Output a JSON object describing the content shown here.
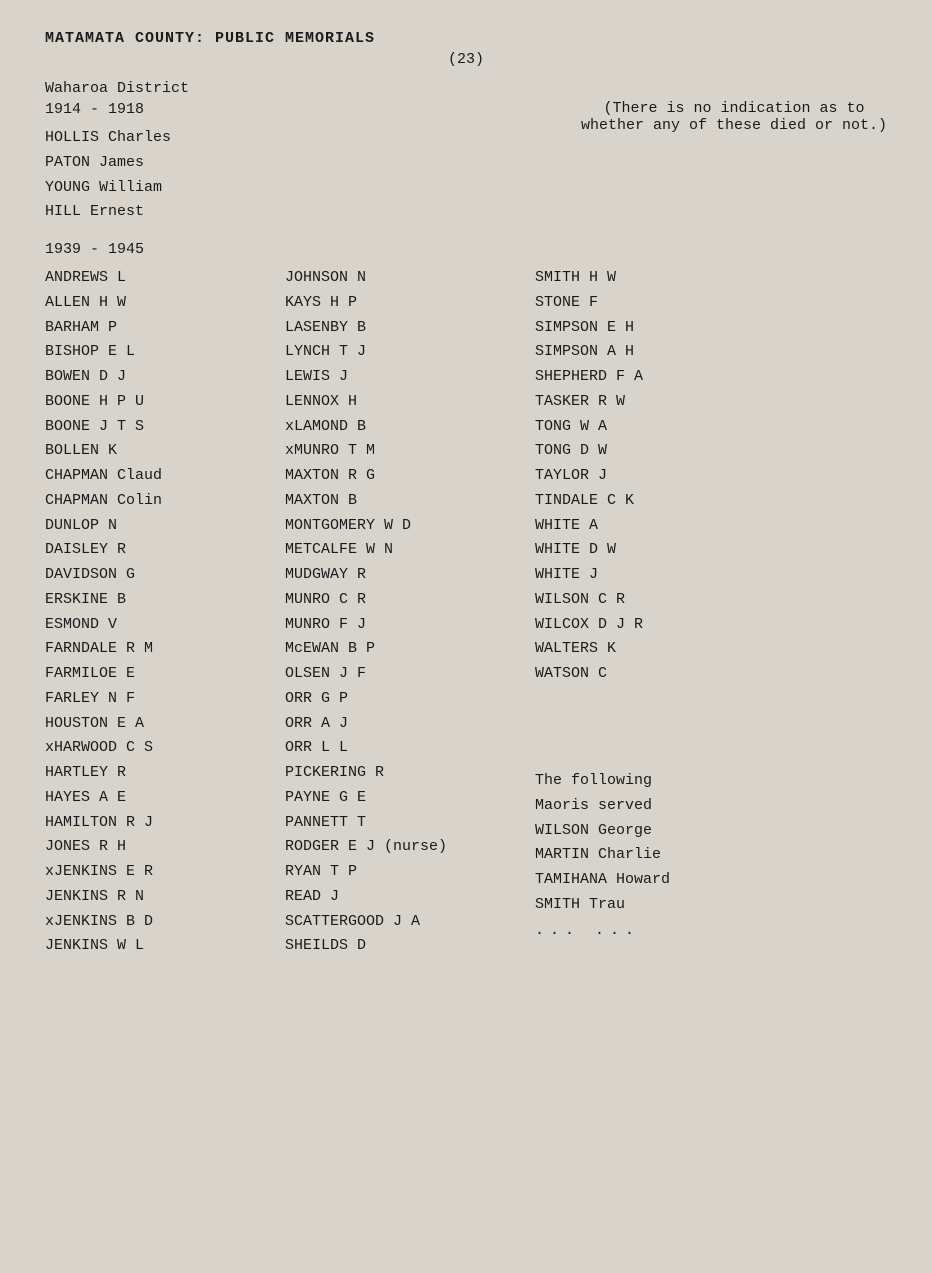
{
  "header": {
    "title": "MATAMATA COUNTY: PUBLIC MEMORIALS",
    "page_number": "(23)"
  },
  "district": {
    "name": "Waharoa District",
    "year_range_ww1": "1914 - 1918",
    "names_ww1": [
      "HOLLIS Charles",
      "PATON James",
      "YOUNG William",
      "HILL Ernest"
    ],
    "note_line1": "(There is no indication as to",
    "note_line2": "whether any of these died or not.)",
    "year_range_ww2": "1939 - 1945"
  },
  "columns": {
    "col1": [
      "ANDREWS L",
      "ALLEN H W",
      "BARHAM P",
      "BISHOP E L",
      "BOWEN D J",
      "BOONE H P U",
      "BOONE J T S",
      "BOLLEN K",
      "CHAPMAN Claud",
      "CHAPMAN Colin",
      "DUNLOP N",
      "DAISLEY R",
      "DAVIDSON G",
      "ERSKINE B",
      "ESMOND V",
      "FARNDALE R M",
      "FARMILOE E",
      "FARLEY N F",
      "HOUSTON E A",
      "xHARWOOD C S",
      "HARTLEY R",
      "HAYES A E",
      "HAMILTON R J",
      "JONES R H",
      "xJENKINS E R",
      "JENKINS R N",
      "xJENKINS B D",
      "JENKINS W L"
    ],
    "col2": [
      "JOHNSON N",
      "KAYS H P",
      "LASENBY B",
      "LYNCH T J",
      "LEWIS J",
      "LENNOX H",
      "xLAMOND B",
      "xMUNRO T M",
      "MAXTON R G",
      "MAXTON B",
      "MONTGOMERY W D",
      "METCALFE W N",
      "MUDGWAY R",
      "MUNRO C R",
      "MUNRO F J",
      "McEWAN B P",
      "OLSEN J F",
      "ORR G P",
      "ORR A J",
      "ORR L L",
      "PICKERING R",
      "PAYNE G E",
      "PANNETT T",
      "RODGER E J (nurse)",
      "RYAN T P",
      "READ J",
      "SCATTERGOOD J A",
      "SHEILDS D"
    ],
    "col3_main": [
      "SMITH H W",
      "STONE F",
      "SIMPSON E H",
      "SIMPSON A H",
      "SHEPHERD F A",
      "TASKER R W",
      "TONG W A",
      "TONG D W",
      "TAYLOR J",
      "TINDALE C K",
      "WHITE A",
      "WHITE D W",
      "WHITE J",
      "WILSON C R",
      "WILCOX D J R",
      "WALTERS K",
      "WATSON C"
    ],
    "following_label1": "The following",
    "following_label2": "Maoris served",
    "col3_maoris": [
      "WILSON George",
      "MARTIN Charlie",
      "TAMIHANA Howard",
      "SMITH Trau"
    ],
    "ellipsis": "...   ..."
  }
}
